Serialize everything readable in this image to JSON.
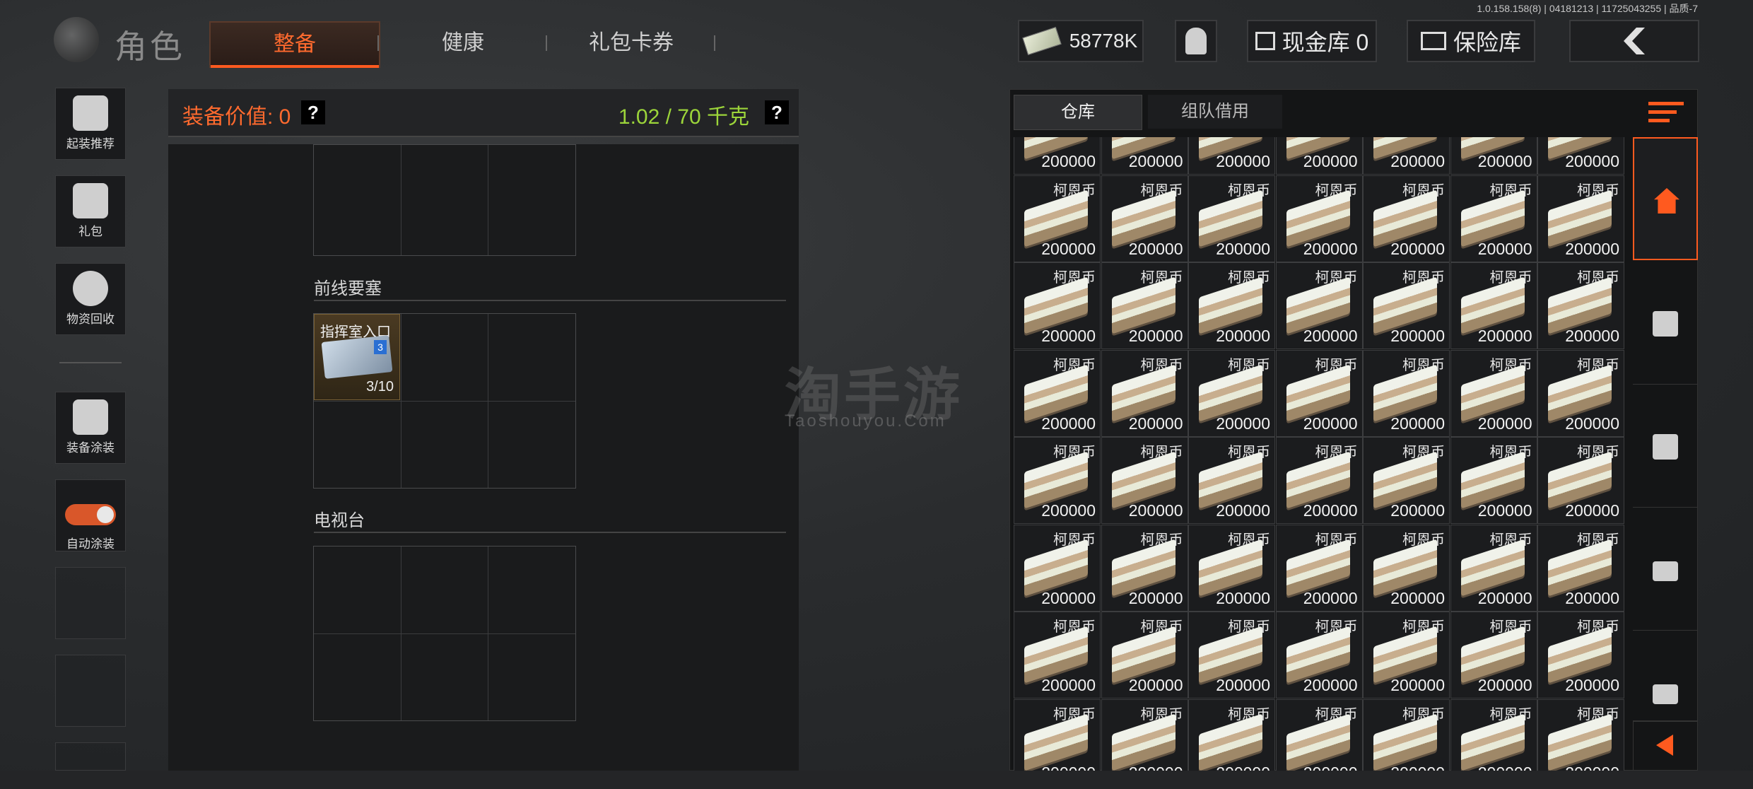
{
  "version_text": "1.0.158.158(8) | 04181213 | 11725043255 | 品质-7",
  "header": {
    "title": "角色",
    "tabs": [
      "整备",
      "健康",
      "礼包卡券"
    ],
    "money": "58778K",
    "cash_vault": "现金库 0",
    "insurance": "保险库"
  },
  "sidebar": {
    "items": [
      "起装推荐",
      "礼包",
      "物资回收",
      "装备涂装",
      "自动涂装"
    ]
  },
  "equipment": {
    "value_label": "装备价值: 0",
    "weight_label": "1.02 / 70 千克",
    "help": "?",
    "sections": [
      "前线要塞",
      "电视台"
    ],
    "item": {
      "name": "指挥室入口",
      "badge": "3",
      "count": "3/10"
    }
  },
  "watermark": {
    "main": "淘手游",
    "sub": "Taoshouyou.Com"
  },
  "warehouse": {
    "tabs": [
      "仓库",
      "组队借用"
    ],
    "item_name": "柯恩币",
    "item_value": "200000"
  },
  "colors": {
    "accent": "#ff5a1f",
    "weight_green": "#9cd53a"
  },
  "icons": [
    "home-icon",
    "crate-icon",
    "crate-icon",
    "box-icon",
    "box-icon",
    "chevron-left-icon"
  ]
}
